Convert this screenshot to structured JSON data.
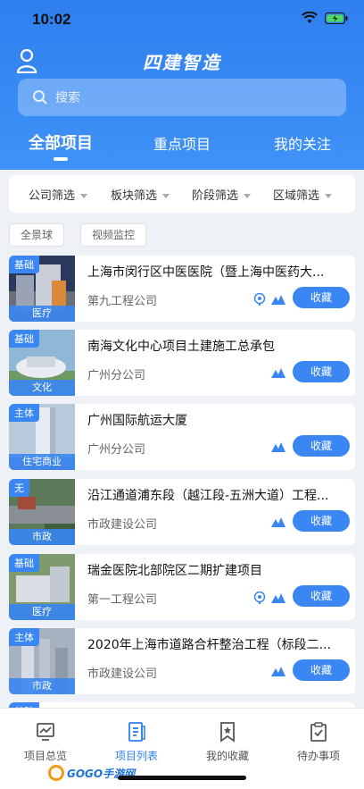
{
  "status": {
    "time": "10:02"
  },
  "app": {
    "title": "四建智造"
  },
  "search": {
    "placeholder": "搜索"
  },
  "tabs": [
    {
      "label": "全部项目",
      "active": true
    },
    {
      "label": "重点项目",
      "active": false
    },
    {
      "label": "我的关注",
      "active": false
    }
  ],
  "filters": [
    "公司筛选",
    "板块筛选",
    "阶段筛选",
    "区域筛选"
  ],
  "chips": [
    "全景球",
    "视频监控"
  ],
  "projects": [
    {
      "tag": "基础",
      "category": "医疗",
      "name": "上海市闵行区中医医院（暨上海中医药大...",
      "company": "第九工程公司",
      "icons": [
        "panorama-icon",
        "chart-icon"
      ],
      "fav": "收藏"
    },
    {
      "tag": "基础",
      "category": "文化",
      "name": "南海文化中心项目土建施工总承包",
      "company": "广州分公司",
      "icons": [
        "chart-icon"
      ],
      "fav": "收藏"
    },
    {
      "tag": "主体",
      "category": "住宅商业",
      "name": "广州国际航运大厦",
      "company": "广州分公司",
      "icons": [
        "chart-icon"
      ],
      "fav": "收藏"
    },
    {
      "tag": "无",
      "category": "市政",
      "name": "沿江通道浦东段（越江段-五洲大道）工程...",
      "company": "市政建设公司",
      "icons": [
        "chart-icon"
      ],
      "fav": "收藏"
    },
    {
      "tag": "基础",
      "category": "医疗",
      "name": "瑞金医院北部院区二期扩建项目",
      "company": "第一工程公司",
      "icons": [
        "panorama-icon",
        "chart-icon"
      ],
      "fav": "收藏"
    },
    {
      "tag": "主体",
      "category": "市政",
      "name": "2020年上海市道路合杆整治工程（标段二...",
      "company": "市政建设公司",
      "icons": [
        "chart-icon"
      ],
      "fav": "收藏"
    }
  ],
  "partial_next_tag": "基础",
  "nav": [
    {
      "label": "项目总览",
      "icon": "overview-icon",
      "active": false
    },
    {
      "label": "项目列表",
      "icon": "list-icon",
      "active": true
    },
    {
      "label": "我的收藏",
      "icon": "bookmark-icon",
      "active": false
    },
    {
      "label": "待办事项",
      "icon": "todo-icon",
      "active": false
    }
  ],
  "watermark": {
    "text": "GOGO手游网"
  },
  "colors": {
    "primary": "#2f7ff0",
    "accent": "#3a86f2",
    "bg": "#eef1f6"
  }
}
